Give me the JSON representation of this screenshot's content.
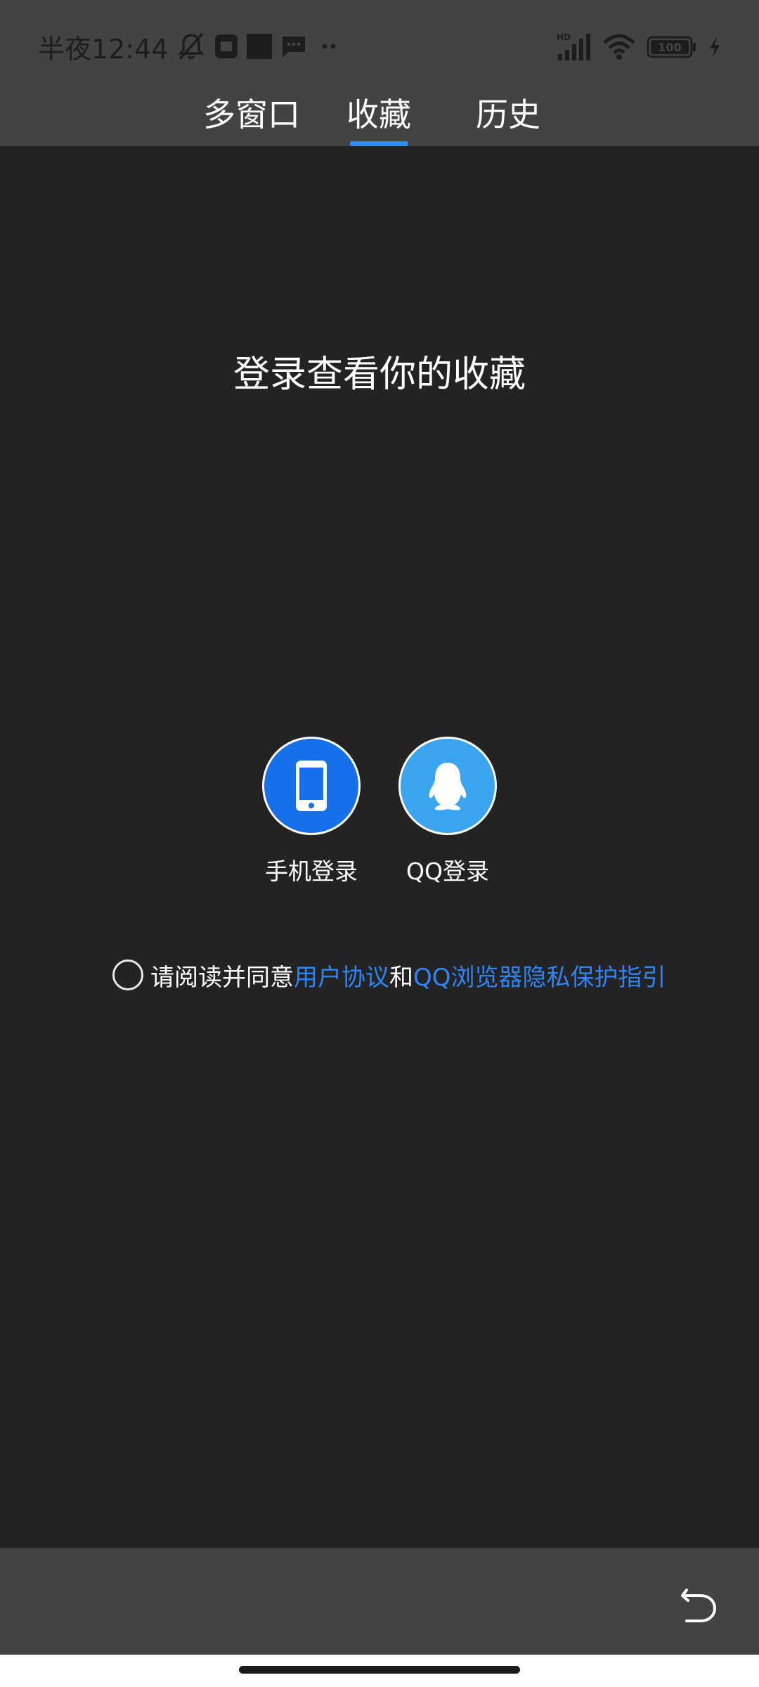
{
  "status_bar": {
    "time": "半夜12:44",
    "icons_left": [
      "mute-icon",
      "app-notification-icon",
      "square-app-icon",
      "message-icon",
      "more-dots-icon"
    ],
    "icons_right": [
      "hd-signal-icon",
      "wifi-icon",
      "battery-icon",
      "charging-icon"
    ],
    "battery_level": "100"
  },
  "tabs": [
    {
      "label": "多窗口",
      "active": false
    },
    {
      "label": "收藏",
      "active": true
    },
    {
      "label": "历史",
      "active": false
    }
  ],
  "main": {
    "headline": "登录查看你的收藏",
    "phone_login_label": "手机登录",
    "qq_login_label": "QQ登录",
    "agreement": {
      "prefix": "请阅读并同意",
      "user_agreement": "用户协议",
      "conjunction": "和",
      "privacy_guide": "QQ浏览器隐私保护指引"
    }
  },
  "colors": {
    "accent": "#2f8dff",
    "phone_button": "#1670ea",
    "qq_button": "#3aa5ee",
    "link": "#2f84f4",
    "background": "#232323",
    "bar": "#434343"
  }
}
